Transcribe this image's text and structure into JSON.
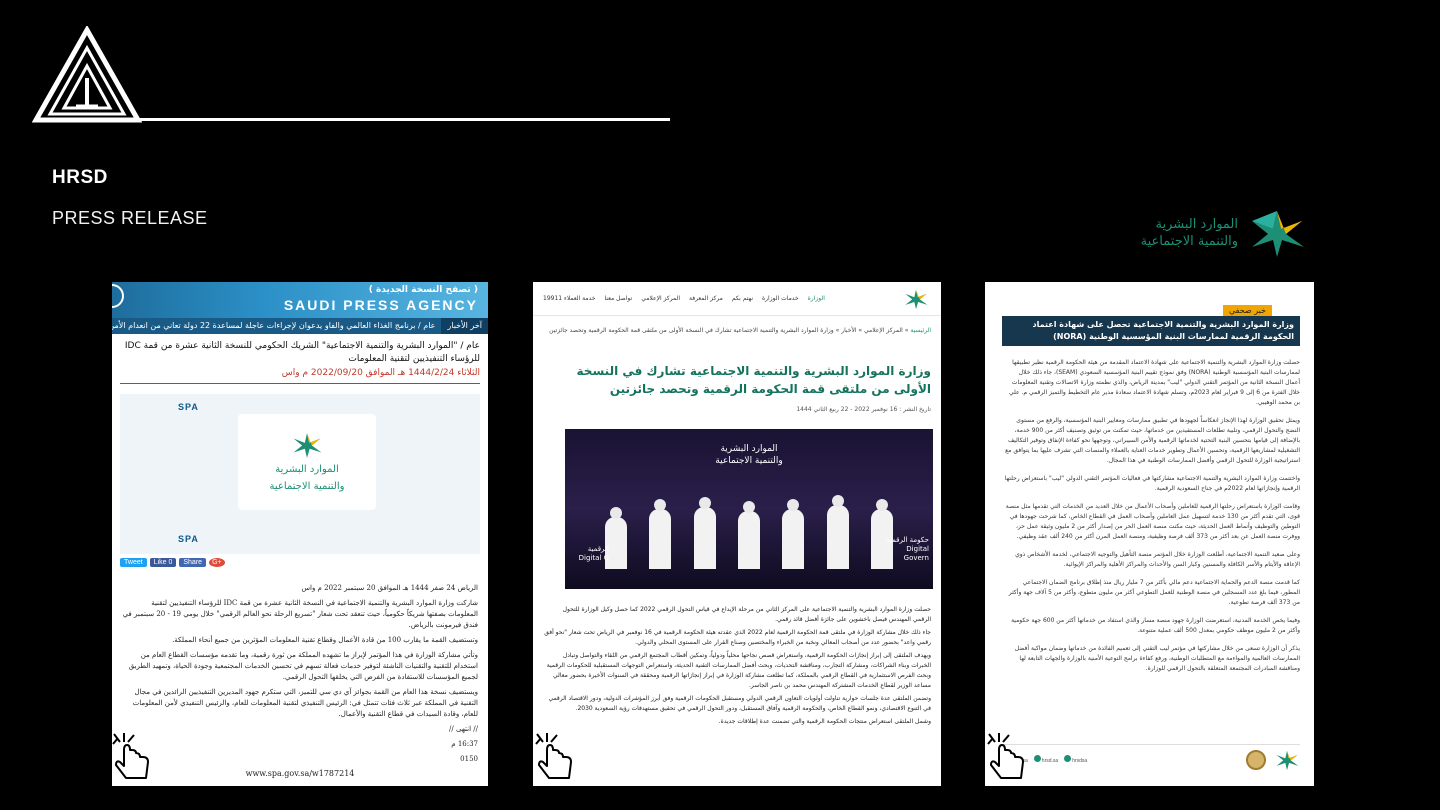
{
  "header": {
    "brand": "HRSD",
    "subtitle": "PRESS RELEASE",
    "ministry_logo_text_1": "الموارد البشرية",
    "ministry_logo_text_2": "والتنمية الاجتماعية"
  },
  "colors": {
    "background": "#000000",
    "hrsd_green": "#1d8f74",
    "spa_blue": "#1e6d9c"
  },
  "card1": {
    "band": "( تصفح النسخة الجديدة )",
    "agency": "SAUDI PRESS AGENCY",
    "ticker_lead": "آخر الأخبار",
    "ticker_text": "عام / برنامج الغذاء العالمي والفاو يدعوان لإجراءات عاجلة لمساعدة 22 دولة تعاني من انعدام الأمن الغذائي",
    "headline": "عام / \"الموارد البشرية والتنمية الاجتماعية\" الشريك الحكومي للنسخة الثانية عشرة من قمة IDC للرؤساء التنفيذيين لتقنية المعلومات",
    "date": "الثلاثاء 1444/2/24 هـ الموافق 2022/09/20 م واس",
    "image_logo_text_1": "الموارد البشرية",
    "image_logo_text_2": "والتنمية الاجتماعية",
    "spa_label": "SPA",
    "share": [
      "Tweet",
      "Like 0",
      "Share",
      "G+"
    ],
    "body": [
      "الرياض 24 صفر 1444 هـ الموافق 20 سبتمبر 2022 م واس",
      "شاركت وزارة الموارد البشرية والتنمية الاجتماعية في النسخة الثانية عشرة من قمة IDC للرؤساء التنفيذيين لتقنية المعلومات بصفتها شريكاً حكومياً، حيث تنعقد تحت شعار \"تسريع الرحلة نحو العالم الرقمي\" خلال يومي 19 - 20 سبتمبر في فندق فيرمونت بالرياض.",
      "وتستضيف القمة ما يقارب 100 من قادة الأعمال وقطاع تقنية المعلومات المؤثرين من جميع أنحاء المملكة.",
      "وتأتي مشاركة الوزارة في هذا المؤتمر لإبراز ما تشهده المملكة من ثورة رقمية، وما تقدمه مؤسسات القطاع العام من استخدام للتقنية والتقنيات الناشئة لتوفير خدمات فعالة تسهم في تحسين الخدمات المجتمعية وجودة الحياة، وتمهيد الطريق لجميع المؤسسات للاستفادة من الفرص التي يخلقها التحول الرقمي.",
      "ويستضيف نسخة هذا العام من القمة بجوائز آي دي سي للتميز، التي ستكرم جهود المديرين التنفيذيين الرائدين في مجال التقنية في المملكة عبر ثلاث فئات تتمثل في: الرئيس التنفيذي لتقنية المعلومات للعام، والرئيس التنفيذي لأمن المعلومات للعام، وقادة السيدات في قطاع التقنية والأعمال.",
      "// انتهى //",
      "16:37 م",
      "0150"
    ],
    "url": "www.spa.gov.sa/w1787214"
  },
  "card2": {
    "nav": [
      "الوزارة",
      "خدمات الوزارة",
      "نهتم بكم",
      "مركز المعرفة",
      "المركز الإعلامي",
      "تواصل معنا",
      "خدمة العملاء 19911"
    ],
    "breadcrumb_home": "الرئيسية",
    "breadcrumb_rest": "» المركز الإعلامي » الأخبار » وزارة الموارد البشرية والتنمية الاجتماعية تشارك في النسخة الأولى من ملتقى قمة الحكومة الرقمية وتحصد جائزتين",
    "title": "وزارة الموارد البشرية والتنمية الاجتماعية تشارك في النسخة الأولى من ملتقى قمة الحكومة الرقمية وتحصد جائزتين",
    "meta": "تاريخ النشر : 16 نوفمبر 2022 - 22 ربيع الثاني 1444",
    "photo_logo_1": "الموارد البشرية",
    "photo_logo_2": "والتنمية الاجتماعية",
    "photo_label_left": "حكومة الرقمية Digital Govern",
    "photo_label_right": "الرقمية Digital G",
    "body": [
      "حصلت وزارة الموارد البشرية والتنمية الاجتماعية على المركز الثاني من مرحلة الإبداع في قياس التحول الرقمي 2022 كما حصل وكيل الوزارة للتحول الرقمي المهندس فيصل باخشوين على جائزة أفضل قائد رقمي.",
      "جاء ذلك خلال مشاركة الوزارة في ملتقى قمة الحكومة الرقمية لعام 2022 الذي عقدته هيئة الحكومة الرقمية في 16 نوفمبر في الرياض تحت شعار \"نحو أفق رقمي واعد\" بحضور عدد من أصحاب المعالي ونخبة من الخبراء والمختصين وصناع القرار على المستوى المحلي والدولي.",
      "ويهدف الملتقى إلى إبراز إنجازات الحكومة الرقمية، واستعراض قصص نجاحها محلياً ودولياً، وتمكين أقطاب المجتمع الرقمي من اللقاء والتواصل وتبادل الخبرات وبناء الشراكات، ومشاركة التجارب، ومناقشة التحديات، وبحث أفضل الممارسات التقنية الحديثة، واستعراض التوجهات المستقبلية للحكومات الرقمية وبحث الفرص الاستثمارية في القطاع الرقمي بالمملكة، كما تطلعت مشاركة الوزارة في إبراز إنجازاتها الرقمية ومحققة في السنوات الأخيرة بحضور معالي مساعد الوزير لقطاع الخدمات المشتركة المهندس محمد بن ناصر الجاسر.",
      "وتضمن الملتقى عدة جلسات حوارية تناولت أولويات التعاون الرقمي الدولي ومستقبل الحكومات الرقمية وفق أبرز المؤشرات الدولية، ودور الاقتصاد الرقمي في التنوع الاقتصادي، ونمو القطاع الخاص، والحكومة الرقمية وآفاق المستقبل، ودور التحول الرقمي في تحقيق مستهدفات رؤية السعودية 2030.",
      "وشمل الملتقى استعراض منتجات الحكومة الرقمية والتي تضمنت عدة إطلاقات جديدة."
    ]
  },
  "card3": {
    "tag": "خبر صحفي",
    "banner": "وزارة الموارد البشرية والتنمية الاجتماعية تحصل على شهادة اعتماد الحكومة الرقمية لممارسات البنية المؤسسية الوطنية (NORA)",
    "body": [
      "حصلت وزارة الموارد البشرية والتنمية الاجتماعية على شهادة الاعتماد المقدمة من هيئة الحكومة الرقمية نظير تطبيقها لممارسات البنية المؤسسية الوطنية (NORA) وفق نموذج تقييم البنية المؤسسية السعودي (SEAM)، جاء ذلك خلال أعمال النسخة الثانية من المؤتمر التقني الدولي \"ليب\" بمدينة الرياض، والذي نظمته وزارة الاتصالات وتقنية المعلومات خلال الفترة من 6 إلى 9 فبراير لعام 2023م، وتسلم شهادة الاعتماد سعادة مدير عام التخطيط والتميز الرقمي م. علي بن محمد الوهيبي.",
      "ويمثل تحقيق الوزارة لهذا الإنجاز انعكاساً لجهودها في تطبيق ممارسات ومعايير البنية المؤسسية، والرفع من مستوى النضج والتحول الرقمي، وتلبية تطلعات المستفيدين من خدماتها، حيث تمكنت من توثيق وتصنيف أكثر من 900 خدمة، بالإضافة إلى قيامها بتحسين البنية التحتية لخدماتها الرقمية والأمن السيبراني، وتوجهها نحو كفاءة الإنفاق وتوفير التكاليف التشغيلية لمشاريعها الرقمية، وتحسين الأعمال وتطوير خدمات العناية بالعملاء والمنصات التي تشرف عليها بما يتوافق مع استراتيجية الوزارة للتحول الرقمي وأفضل الممارسات الوطنية في هذا المجال.",
      "واختتمت وزارة الموارد البشرية والتنمية الاجتماعية مشاركتها في فعاليات المؤتمر التقني الدولي \"ليب\" باستعراض رحلتها الرقمية وإنجازاتها لعام 2022م في جناح السعودية الرقمية.",
      "وقامت الوزارة باستعراض رحلتها الرقمية للعاملين وأصحاب الأعمال من خلال العديد من الخدمات التي تقدمها مثل منصة قوى، التي تقدم أكثر من 130 خدمة لتسهيل عمل العاملين وأصحاب العمل في القطاع الخاص، كما شرحت جهودها في التوطين والتوظيف وأنماط العمل الحديثة، حيث مكنت منصة العمل الحر من إصدار أكثر من 2 مليون وثيقة عمل حر، ووفرت منصة العمل عن بعد أكثر من 373 ألف فرصة وظيفية، ومنصة العمل المرن أكثر من 240 ألف عقد وظيفي.",
      "وعلى صعيد التنمية الاجتماعية، أطلعت الوزارة خلال المؤتمر منصة التأهيل والتوجيه الاجتماعي، لخدمة الأشخاص ذوي الإعاقة والأيتام والأسر الكافلة والمسنين وكبار السن والأحداث والمراكز الأهلية والمراكز الإيوائية.",
      "كما قدمت منصة الدعم والحماية الاجتماعية دعم مالي بأكثر من 7 مليار ريال منذ إطلاق برنامج الضمان الاجتماعي المطور، فيما بلغ عدد المسجلين في منصة الوطنية للعمل التطوعي أكثر من مليون متطوع، وأكثر من 5 آلاف جهة وأكثر من 373 ألف فرصة تطوعية.",
      "وفيما يخص الخدمة المدنية، استعرضت الوزارة جهود منصة مسار والذي استفاد من خدماتها أكثر من 600 جهة حكومية وأكثر من 2 مليون موظف حكومي بمعدل 500 ألف عملية متنوعة.",
      "يذكر أن الوزارة تسعى من خلال مشاركتها في مؤتمر ليب التقني إلى تعميم الفائدة من خدماتها وضمان مواكبة أفضل الممارسات العالمية والمواءمة مع المتطلبات الوطنية، ورفع كفاءة برامج التوعية الأمنية بالوزارة والجهات التابعة لها ومناقشة المبادرات المجتمعة المتعلقة بالتحول الرقمي للوزارة."
    ],
    "footer_handles": [
      "hrsd_sa",
      "hrsd.sa",
      "hrsdsa"
    ]
  },
  "icons": {
    "logo": "triangle-logo-icon",
    "ministry": "hrsd-star-icon",
    "pointer": "hand-pointer-icon"
  }
}
